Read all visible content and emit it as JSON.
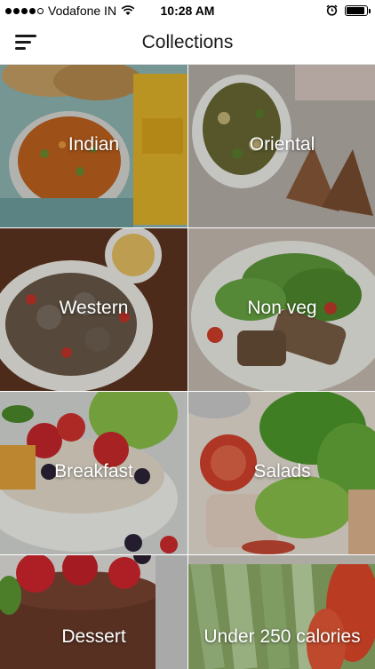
{
  "status_bar": {
    "carrier": "Vodafone IN",
    "time": "10:28 AM",
    "signal_bars": 4,
    "battery_level": 0.9
  },
  "nav": {
    "title": "Collections",
    "menu_icon": "hamburger-menu-icon"
  },
  "collections": [
    {
      "label": "Indian"
    },
    {
      "label": "Oriental"
    },
    {
      "label": "Western"
    },
    {
      "label": "Non veg"
    },
    {
      "label": "Breakfast"
    },
    {
      "label": "Salads"
    },
    {
      "label": "Dessert"
    },
    {
      "label": "Under 250 calories"
    }
  ]
}
